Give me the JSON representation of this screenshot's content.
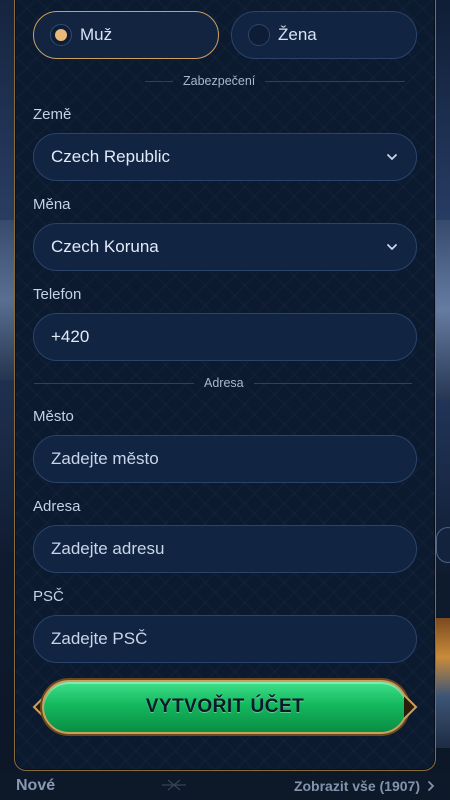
{
  "gender": {
    "male_label": "Muž",
    "female_label": "Žena",
    "selected": "male"
  },
  "sections": {
    "security": "Zabezpečení",
    "address": "Adresa"
  },
  "fields": {
    "country": {
      "label": "Země",
      "value": "Czech Republic"
    },
    "currency": {
      "label": "Měna",
      "value": "Czech Koruna"
    },
    "phone": {
      "label": "Telefon",
      "value": "+420"
    },
    "city": {
      "label": "Město",
      "placeholder": "Zadejte město"
    },
    "address": {
      "label": "Adresa",
      "placeholder": "Zadejte adresu"
    },
    "zip": {
      "label": "PSČ",
      "placeholder": "Zadejte PSČ"
    }
  },
  "cta": {
    "label": "VYTVOŘIT ÚČET"
  },
  "bottom_bar": {
    "section_title": "Nové",
    "view_all": "Zobrazit vše (1907)"
  },
  "colors": {
    "accent_gold": "#c9a15f",
    "cta_green": "#14b95e",
    "field_bg": "#112441",
    "modal_bg": "#0c1a30"
  }
}
